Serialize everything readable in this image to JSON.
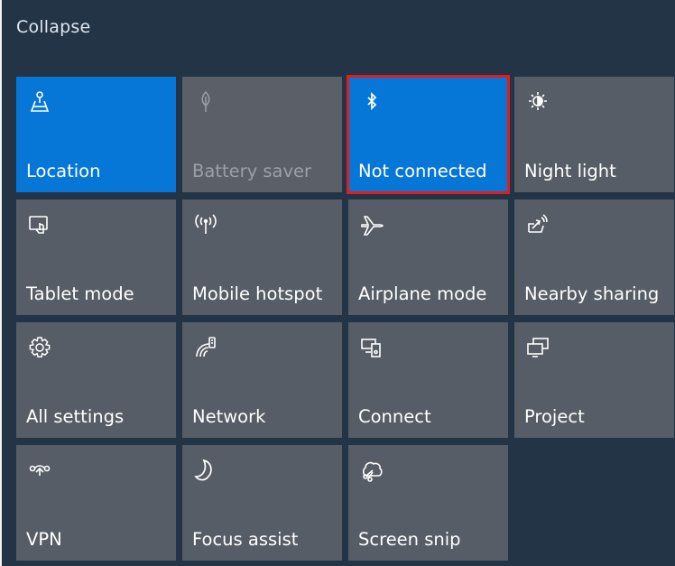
{
  "header": {
    "collapse_label": "Collapse"
  },
  "tiles": [
    {
      "label": "Location",
      "icon": "location-icon",
      "state": "on"
    },
    {
      "label": "Battery saver",
      "icon": "battery-saver-icon",
      "state": "disabled"
    },
    {
      "label": "Not connected",
      "icon": "bluetooth-icon",
      "state": "on",
      "selected": true
    },
    {
      "label": "Night light",
      "icon": "night-light-icon",
      "state": "off"
    },
    {
      "label": "Tablet mode",
      "icon": "tablet-mode-icon",
      "state": "off"
    },
    {
      "label": "Mobile hotspot",
      "icon": "mobile-hotspot-icon",
      "state": "off"
    },
    {
      "label": "Airplane mode",
      "icon": "airplane-icon",
      "state": "off"
    },
    {
      "label": "Nearby sharing",
      "icon": "nearby-sharing-icon",
      "state": "off"
    },
    {
      "label": "All settings",
      "icon": "gear-icon",
      "state": "off"
    },
    {
      "label": "Network",
      "icon": "network-icon",
      "state": "off"
    },
    {
      "label": "Connect",
      "icon": "connect-icon",
      "state": "off"
    },
    {
      "label": "Project",
      "icon": "project-icon",
      "state": "off"
    },
    {
      "label": "VPN",
      "icon": "vpn-icon",
      "state": "off"
    },
    {
      "label": "Focus assist",
      "icon": "focus-assist-icon",
      "state": "off"
    },
    {
      "label": "Screen snip",
      "icon": "screen-snip-icon",
      "state": "off"
    }
  ],
  "colors": {
    "panel_bg": "#233446",
    "tile_bg": "#575d66",
    "tile_active": "#0677d7",
    "highlight": "#e61b1b"
  }
}
